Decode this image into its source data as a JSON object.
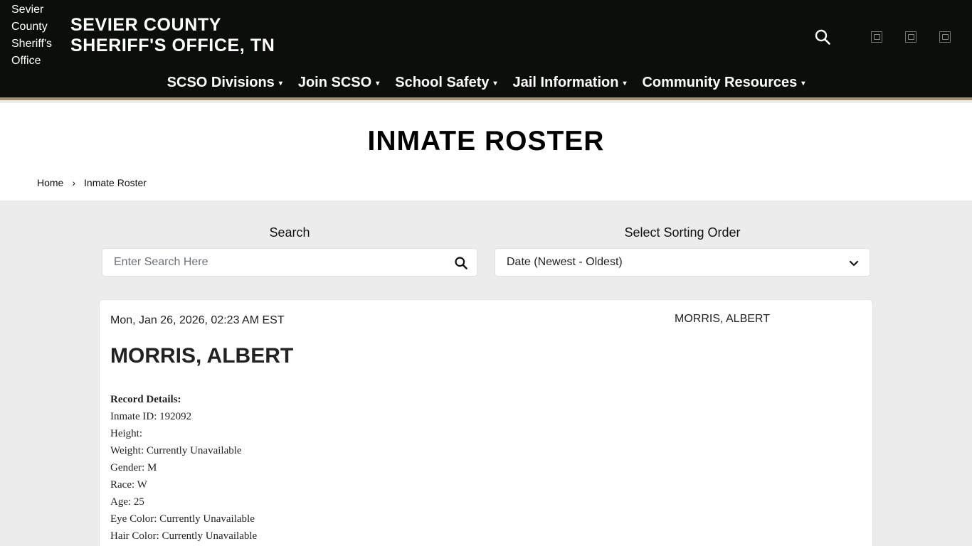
{
  "header": {
    "logo_alt": "Sevier County Sheriff's Office",
    "title_line1": "SEVIER COUNTY",
    "title_line2": "SHERIFF'S OFFICE, TN"
  },
  "nav": {
    "items": [
      {
        "label": "SCSO Divisions"
      },
      {
        "label": "Join SCSO"
      },
      {
        "label": "School Safety"
      },
      {
        "label": "Jail Information"
      },
      {
        "label": "Community Resources"
      }
    ],
    "caret": "▾"
  },
  "page": {
    "title": "INMATE ROSTER",
    "breadcrumb": {
      "home": "Home",
      "separator": "›",
      "current": "Inmate Roster"
    }
  },
  "search": {
    "label": "Search",
    "placeholder": "Enter Search Here"
  },
  "sort": {
    "label": "Select Sorting Order",
    "selected": "Date (Newest - Oldest)"
  },
  "record": {
    "datetime": "Mon, Jan 26, 2026, 02:23 AM EST",
    "photo_alt": "MORRIS, ALBERT",
    "name": "MORRIS, ALBERT",
    "details_heading": "Record Details:",
    "details": [
      "Inmate ID: 192092",
      "Height:",
      "Weight: Currently Unavailable",
      "Gender: M",
      "Race: W",
      "Age: 25",
      "Eye Color: Currently Unavailable",
      "Hair Color: Currently Unavailable"
    ]
  },
  "colors": {
    "header_bg": "#0b0f0a",
    "accent_border": "#a39070",
    "page_bg": "#ececec"
  },
  "icons": [
    "search-icon",
    "social-icon",
    "caret-down-icon",
    "chevron-down-icon"
  ]
}
